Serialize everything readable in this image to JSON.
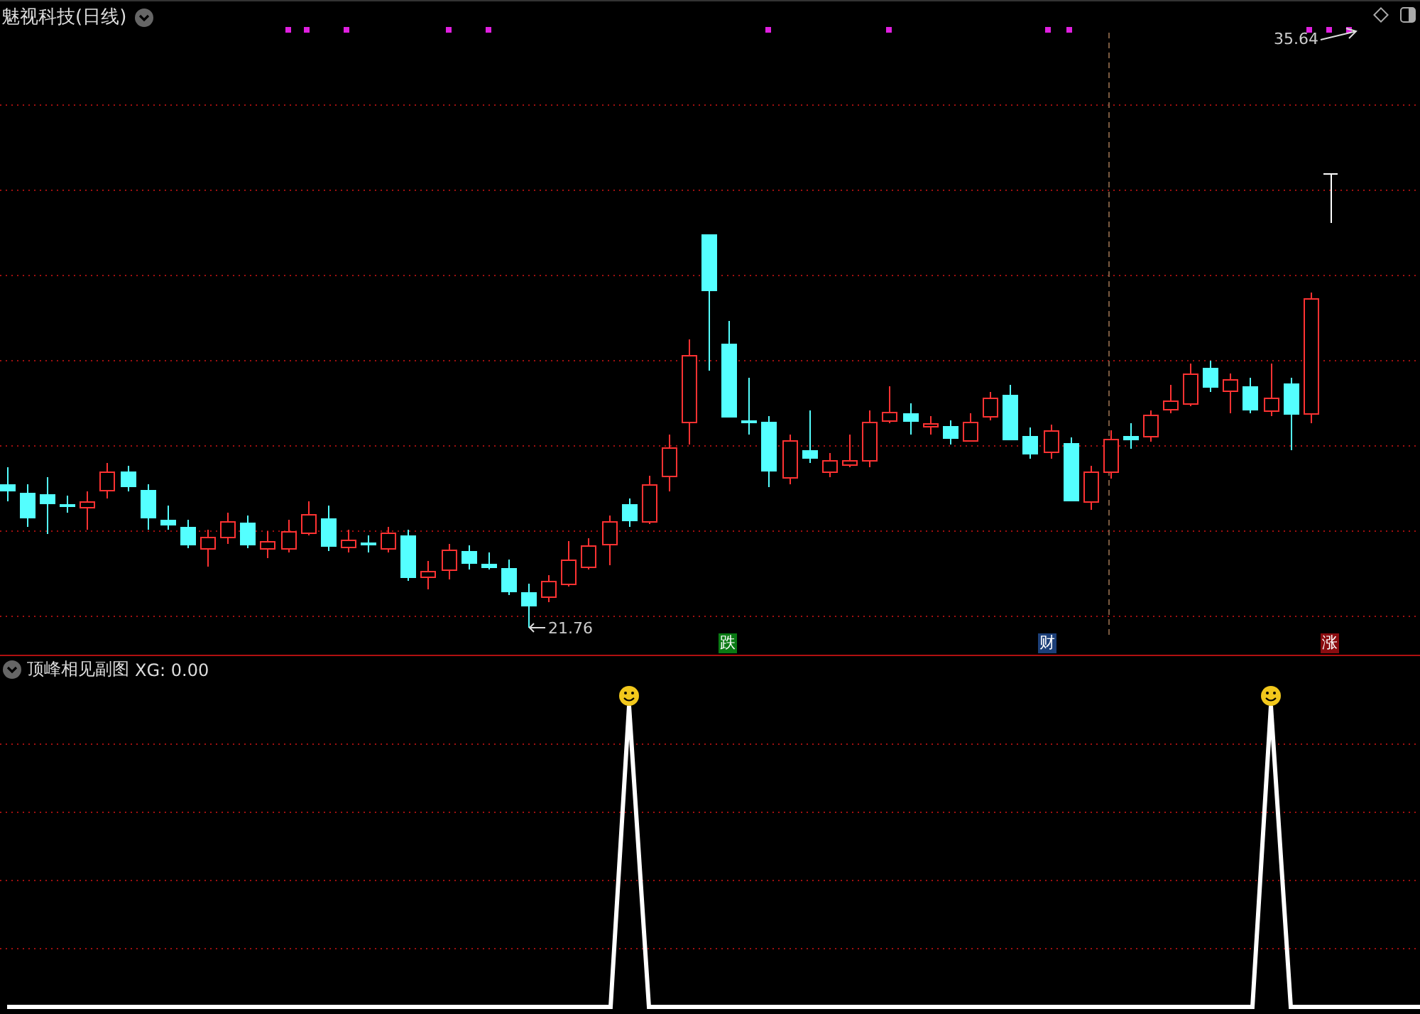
{
  "chart": {
    "title": "魅视科技(日线)",
    "high_label": "35.64",
    "low_label": "21.76",
    "markers": [
      {
        "label": "跌",
        "color": "#0a7a14"
      },
      {
        "label": "财",
        "color": "#1c3f78"
      },
      {
        "label": "涨",
        "color": "#8a0c10"
      }
    ]
  },
  "indicator": {
    "name": "顶峰相见副图",
    "reading": "XG: 0.00"
  }
}
